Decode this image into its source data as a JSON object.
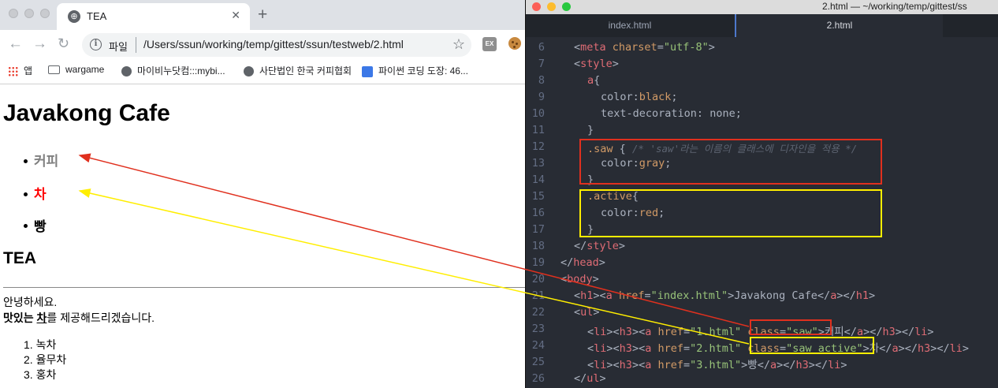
{
  "browser": {
    "tab_title": "TEA",
    "tab_icon": "globe-icon",
    "url_label": "파일",
    "url": "/Users/ssun/working/temp/gittest/ssun/testweb/2.html",
    "ext_label": "EX",
    "bookmarks": [
      {
        "label": "앱",
        "icon": "apps-icon"
      },
      {
        "label": "wargame",
        "icon": "folder-icon"
      },
      {
        "label": "마이비누닷컴:::mybi...",
        "icon": "globe-icon"
      },
      {
        "label": "사단법인 한국 커피협회",
        "icon": "globe-icon"
      },
      {
        "label": "파이썬 코딩 도장: 46...",
        "icon": "site-icon"
      }
    ]
  },
  "page": {
    "title": "Javakong Cafe",
    "menu": [
      {
        "label": "커피",
        "color": "#808080"
      },
      {
        "label": "차",
        "color": "#ff0000"
      },
      {
        "label": "빵",
        "color": "#000000"
      }
    ],
    "subtitle": "TEA",
    "greeting": "안녕하세요.",
    "desc_bold1": "맛있는 ",
    "desc_bold2": "차",
    "desc_rest": "를 제공해드리겠습니다.",
    "teas": [
      "1. 녹차",
      "2. 율무차",
      "3. 홍차"
    ]
  },
  "editor": {
    "window_title": "2.html — ~/working/temp/gittest/ss",
    "tabs": [
      {
        "label": "index.html",
        "active": false
      },
      {
        "label": "2.html",
        "active": true
      }
    ],
    "lines": [
      {
        "n": "6"
      },
      {
        "n": "7"
      },
      {
        "n": "8"
      },
      {
        "n": "9"
      },
      {
        "n": "10"
      },
      {
        "n": "11"
      },
      {
        "n": "12"
      },
      {
        "n": "13"
      },
      {
        "n": "14"
      },
      {
        "n": "15"
      },
      {
        "n": "16"
      },
      {
        "n": "17"
      },
      {
        "n": "18"
      },
      {
        "n": "19"
      },
      {
        "n": "20"
      },
      {
        "n": "21"
      },
      {
        "n": "22"
      },
      {
        "n": "23"
      },
      {
        "n": "24"
      },
      {
        "n": "25"
      },
      {
        "n": "26"
      }
    ]
  },
  "code": {
    "l6": [
      "<",
      "meta",
      " charset",
      "=",
      "\"utf-8\"",
      ">"
    ],
    "l7": [
      "<",
      "style",
      ">"
    ],
    "l8": [
      "a",
      "{"
    ],
    "l9": [
      "color",
      ":",
      "black",
      ";"
    ],
    "l10": [
      "text-decoration",
      ": ",
      "none",
      ";"
    ],
    "l11": [
      "}"
    ],
    "l12": [
      ".saw",
      " { ",
      "/* 'saw'라는 이름의 클래스에 디자인을 적용 */"
    ],
    "l13": [
      "color",
      ":",
      "gray",
      ";"
    ],
    "l14": [
      "}"
    ],
    "l15": [
      ".active",
      "{"
    ],
    "l16": [
      "color",
      ":",
      "red",
      ";"
    ],
    "l17": [
      "}"
    ],
    "l18": [
      "</",
      "style",
      ">"
    ],
    "l19": [
      "</",
      "head",
      ">"
    ],
    "l20": [
      "<",
      "body",
      ">"
    ],
    "l21": [
      "<",
      "h1",
      "><",
      "a",
      " href",
      "=",
      "\"index.html\"",
      ">Javakong Cafe</",
      "a",
      "></",
      "h1",
      ">"
    ],
    "l22": [
      "<",
      "ul",
      ">"
    ],
    "l23": [
      "<",
      "li",
      "><",
      "h3",
      "><",
      "a",
      " href",
      "=",
      "\"1.html\"",
      " class",
      "=",
      "\"saw\"",
      ">커피</",
      "a",
      "></",
      "h3",
      "></",
      "li",
      ">"
    ],
    "l24": [
      "<",
      "li",
      "><",
      "h3",
      "><",
      "a",
      " href",
      "=",
      "\"2.html\"",
      " class",
      "=",
      "\"saw active\"",
      ">차</",
      "a",
      "></",
      "h3",
      "></",
      "li",
      ">"
    ],
    "l25": [
      "<",
      "li",
      "><",
      "h3",
      "><",
      "a",
      " href",
      "=",
      "\"3.html\"",
      ">빵</",
      "a",
      "></",
      "h3",
      "></",
      "li",
      ">"
    ],
    "l26": [
      "</",
      "ul",
      ">"
    ]
  },
  "annotations": {
    "red_color": "#e0301e",
    "yellow_color": "#ffee00"
  }
}
